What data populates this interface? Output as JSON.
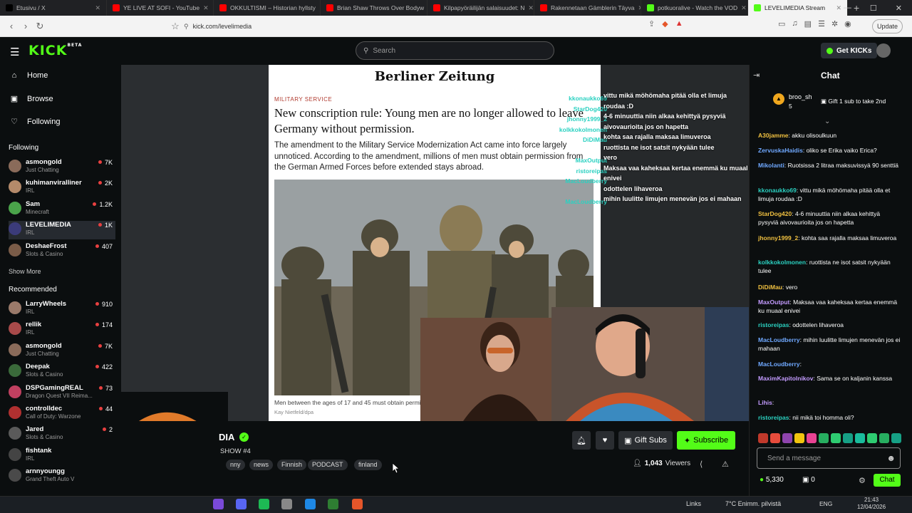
{
  "browser": {
    "tabs": [
      {
        "title": "Etusivu / X",
        "icon": "x-icon",
        "color": "#000000"
      },
      {
        "title": "YE LIVE AT SOFI - YouTube",
        "icon": "youtube-icon",
        "color": "#ff0000"
      },
      {
        "title": "OKKULTISMI – Historian hyllsty",
        "icon": "youtube-icon",
        "color": "#ff0000"
      },
      {
        "title": "Brian Shaw Throws Over Bodyw",
        "icon": "youtube-icon",
        "color": "#ff0000"
      },
      {
        "title": "Kilpapyöräilijän salaisuudet: N",
        "icon": "youtube-icon",
        "color": "#ff0000"
      },
      {
        "title": "Rakennetaan Gämblerin Täyva",
        "icon": "youtube-icon",
        "color": "#ff0000"
      },
      {
        "title": "potkuoralive - Watch the VOD",
        "icon": "kick-icon",
        "color": "#53fc18"
      },
      {
        "title": "LEVELIMEDIA Stream",
        "icon": "kick-icon",
        "color": "#53fc18"
      }
    ],
    "new_tab": "+",
    "url": "kick.com/levelimedia",
    "update_label": "Update"
  },
  "header": {
    "logo": "KICK",
    "logo_sup": "BETA",
    "search_placeholder": "Search",
    "get_kicks": "Get KICKs"
  },
  "sidebar": {
    "nav": [
      {
        "label": "Home",
        "icon": "home-icon",
        "glyph": "⌂"
      },
      {
        "label": "Browse",
        "icon": "browse-icon",
        "glyph": "▣"
      },
      {
        "label": "Following",
        "icon": "heart-icon",
        "glyph": "♡"
      }
    ],
    "following_title": "Following",
    "following": [
      {
        "name": "asmongold",
        "category": "Just Chatting",
        "viewers": "7K",
        "color": "#8a6b5a"
      },
      {
        "name": "kuhimanviralliner",
        "category": "IRL",
        "viewers": "2K",
        "color": "#b48a6a"
      },
      {
        "name": "Sam",
        "category": "Minecraft",
        "viewers": "1.2K",
        "color": "#4aa34a"
      },
      {
        "name": "LEVELIMEDIA",
        "category": "IRL",
        "viewers": "1K",
        "color": "#3b3b7a"
      },
      {
        "name": "DeshaeFrost",
        "category": "Slots & Casino",
        "viewers": "407",
        "color": "#7a5c48"
      }
    ],
    "show_more": "Show More",
    "recommended_title": "Recommended",
    "recommended": [
      {
        "name": "LarryWheels",
        "category": "IRL",
        "viewers": "910",
        "color": "#9a7a6a"
      },
      {
        "name": "rellik",
        "category": "IRL",
        "viewers": "174",
        "color": "#a84a4a"
      },
      {
        "name": "asmongold",
        "category": "Just Chatting",
        "viewers": "7K",
        "color": "#8a6b5a"
      },
      {
        "name": "Deepak",
        "category": "Slots & Casino",
        "viewers": "422",
        "color": "#3a6a3a"
      },
      {
        "name": "DSPGamingREAL",
        "category": "Dragon Quest VII Reima...",
        "viewers": "73",
        "color": "#c04060"
      },
      {
        "name": "controlldec",
        "category": "Call of Duty: Warzone",
        "viewers": "44",
        "color": "#b03030"
      },
      {
        "name": "Jared",
        "category": "Slots & Casino",
        "viewers": "2",
        "color": "#5a5a5a"
      },
      {
        "name": "fishtank",
        "category": "IRL",
        "viewers": "",
        "color": "#444444"
      },
      {
        "name": "arnnyoungg",
        "category": "Grand Theft Auto V",
        "viewers": "",
        "color": "#4a4a4a"
      }
    ]
  },
  "video": {
    "paper": "Berliner Zeitung",
    "kicker": "MILITARY SERVICE",
    "headline": "New conscription rule: Young men are no longer allowed to leave Germany without permission.",
    "lede": "The amendment to the Military Service Modernization Act came into force largely unnoticed. According to the amendment, millions of men must obtain permission from the German Armed Forces before extended stays abroad.",
    "caption": "Men between the ages of 17 and 45 must obtain permis",
    "credit": "Kay Nietfeld/dpa",
    "overlay_names": [
      "kkonaukko69",
      "StarDog420",
      "jhonny1999_2",
      "kolkkokolmonen",
      "DiDiMau",
      "",
      "MaxOutput",
      "ristoreipas",
      "MacLoudberry",
      "",
      "MacLoudberry"
    ],
    "overlay_messages": [
      "vittu mikä möhömaha pitää olla et limuja roudaa :D",
      "4-6 minuuttia niin alkaa kehittyä pysyviä aivovaurioita jos on hapetta",
      "kohta saa rajalla maksaa limuveroa",
      "ruottista ne isot satsit nykyään tulee",
      "vero",
      "Maksaa vaa kaheksaa kertaa enemmä ku muaal enivei",
      "odottelen lihaveroa",
      "mihin luulitte limujen menevän jos ei mahaan"
    ]
  },
  "stream": {
    "name": "DIA",
    "title": "SHOW #4",
    "tags": [
      "nny",
      "news",
      "Finnish",
      "PODCAST",
      "finland"
    ],
    "gift_subs": "Gift Subs",
    "subscribe": "Subscribe",
    "viewers": "1,043",
    "viewers_label": "Viewers"
  },
  "chat": {
    "title": "Chat",
    "pinned_user": "broo_sh",
    "pinned_count": "5",
    "pinned_text": "Gift 1 sub to take 2nd",
    "messages": [
      {
        "user": "A30jamme",
        "color": "#f0c040",
        "text": "akku olisoulkuun"
      },
      {
        "user": "ZervuskaHaidis",
        "color": "#6fa8ff",
        "text": "oliko se Erika vaiko Erica?"
      },
      {
        "user": "Mikolanti",
        "color": "#6fa8ff",
        "text": "Ruotsissa 2 litraa maksuvissyä 90 senttiä"
      },
      {
        "user": "kkonaukko69",
        "color": "#2bd1c1",
        "text": "vittu mikä möhömaha pitää olla et limuja roudaa :D"
      },
      {
        "user": "StarDog420",
        "color": "#f0c040",
        "text": "4-6 minuuttia niin alkaa kehittyä pysyviä aivovaurioita jos on hapetta"
      },
      {
        "user": "jhonny1999_2",
        "color": "#f0c040",
        "text": "kohta saa rajalla maksaa limuveroa"
      },
      {
        "user": "kolkkokolmonen",
        "color": "#2bd1c1",
        "text": "ruottista ne isot satsit nykyään tulee"
      },
      {
        "user": "DiDiMau",
        "color": "#f0c040",
        "text": "vero"
      },
      {
        "user": "MaxOutput",
        "color": "#c39bff",
        "text": "Maksaa vaa kaheksaa kertaa enemmä ku muaal enivei"
      },
      {
        "user": "ristoreipas",
        "color": "#2bd1c1",
        "text": "odottelen lihaveroa"
      },
      {
        "user": "MacLoudberry",
        "color": "#6fa8ff",
        "text": "mihin luulitte limujen menevän jos ei mahaan"
      },
      {
        "user": "MacLoudberry",
        "color": "#6fa8ff",
        "text": ""
      },
      {
        "user": "MaximKapitolnikov",
        "color": "#c39bff",
        "text": "Sama se on kaljanin kanssa"
      },
      {
        "user": "Lihis",
        "color": "#c39bff",
        "text": ""
      },
      {
        "user": "ristoreipas",
        "color": "#2bd1c1",
        "text": "nii mikä toi homma oli?"
      }
    ],
    "input_placeholder": "Send a message",
    "kicks": "5,330",
    "gifts": "0",
    "send": "Chat"
  },
  "taskbar": {
    "links": "Links",
    "weather": "7°C  Enimm. pilvistä",
    "lang": "ENG",
    "time": "21:43",
    "date": "12/04/2026"
  }
}
